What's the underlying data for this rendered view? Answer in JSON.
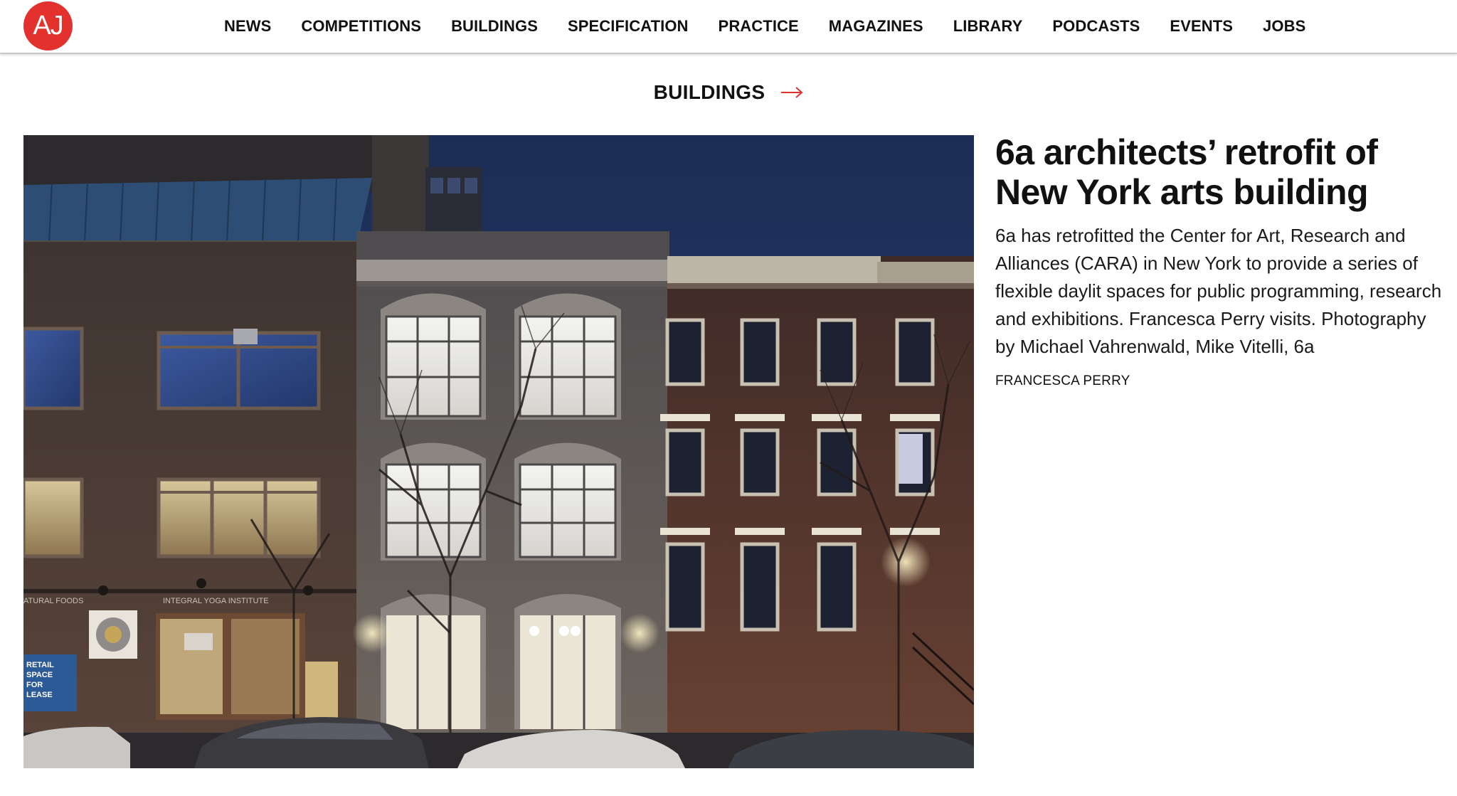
{
  "logo": {
    "text": "AJ",
    "color": "#e3312d"
  },
  "nav": {
    "items": [
      {
        "label": "NEWS"
      },
      {
        "label": "COMPETITIONS"
      },
      {
        "label": "BUILDINGS"
      },
      {
        "label": "SPECIFICATION"
      },
      {
        "label": "PRACTICE"
      },
      {
        "label": "MAGAZINES"
      },
      {
        "label": "LIBRARY"
      },
      {
        "label": "PODCASTS"
      },
      {
        "label": "EVENTS"
      },
      {
        "label": "JOBS"
      }
    ]
  },
  "section": {
    "label": "BUILDINGS",
    "icon": "arrow-right-icon",
    "accent": "#e3312d"
  },
  "article": {
    "headline": "6a architects’ retrofit of New York arts building",
    "standfirst": "6a has retrofitted the Center for Art, Research and Alliances (CARA) in New York to provide a series of flexible daylit spaces for public programming, research and exhibitions. Francesca Perry visits. Photography by Michael Vahrenwald, Mike Vitelli, 6a",
    "author": "FRANCESCA PERRY"
  },
  "hero_image": {
    "signs": {
      "natural_foods": "ATURAL FOODS",
      "yoga": "INTEGRAL YOGA INSTITUTE",
      "retail_1": "RETAIL",
      "retail_2": "SPACE",
      "retail_3": "FOR",
      "retail_4": "LEASE"
    }
  }
}
